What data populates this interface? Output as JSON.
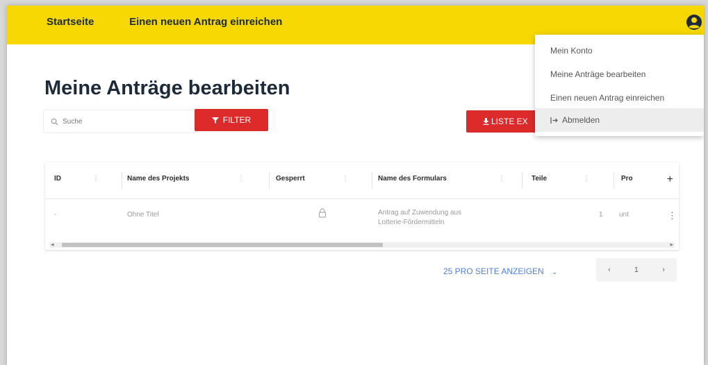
{
  "nav": {
    "home": "Startseite",
    "new_application": "Einen neuen Antrag einreichen"
  },
  "page_title": "Meine Anträge bearbeiten",
  "search": {
    "placeholder": "Suche"
  },
  "buttons": {
    "filter": "FILTER",
    "export": "LISTE EX"
  },
  "table": {
    "columns": [
      "ID",
      "Name des Projekts",
      "Gesperrt",
      "Name des Formulars",
      "Teile",
      "Pro"
    ],
    "add_column": "+",
    "row": {
      "id": "-",
      "project": "Ohne Titel",
      "form_line1": "Antrag auf Zuwendung aus",
      "form_line2": "Lotterie-Fördermitteln",
      "parts": "1",
      "pro": "unt",
      "menu": "⋮"
    }
  },
  "pagination": {
    "per_page": "25 PRO SEITE ANZEIGEN",
    "prev": "‹",
    "page": "1",
    "next": "›"
  },
  "account_menu": {
    "items": [
      "Mein Konto",
      "Meine Anträge bearbeiten",
      "Einen neuen Antrag einreichen",
      "Abmelden"
    ]
  },
  "colors": {
    "topbar": "#f7d700",
    "accent": "#dc2a2a",
    "link": "#4f7fd8"
  }
}
